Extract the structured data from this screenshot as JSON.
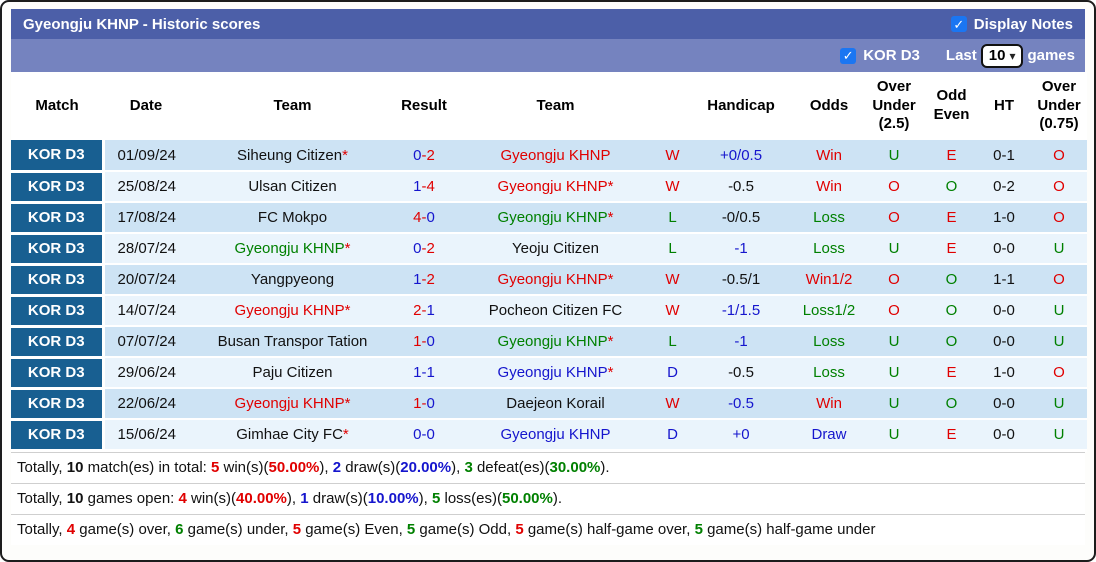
{
  "colors": {
    "red": "#e00000",
    "green": "#008000",
    "blue": "#1515cd",
    "black": "#111111",
    "titlebar_bg": "#4c5fa8",
    "subbar_bg": "#7583bf",
    "league_cell_bg": "#185f91",
    "row_stripe_dark": "#cde3f4",
    "row_stripe_light": "#eaf4fc",
    "checkbox_blue": "#1b76f2"
  },
  "header": {
    "title": "Gyeongju KHNP - Historic scores",
    "display_notes_label": "Display Notes",
    "display_notes_checked": true
  },
  "subheader": {
    "league_label": "KOR D3",
    "league_checked": true,
    "last_label": "Last",
    "games_count": "10",
    "games_label": "games"
  },
  "table": {
    "headers": [
      "Match",
      "Date",
      "Team",
      "Result",
      "Team",
      "",
      "Handicap",
      "Odds",
      "Over Under (2.5)",
      "Odd Even",
      "HT",
      "Over Under (0.75)"
    ],
    "rows": [
      {
        "league": "KOR D3",
        "date": "01/09/24",
        "home": {
          "name": "Siheung Citizen",
          "star": true,
          "color": "black"
        },
        "score": {
          "h": "0",
          "a": "2",
          "hc": "blue",
          "ac": "red",
          "dc": "red"
        },
        "away": {
          "name": "Gyeongju KHNP",
          "star": false,
          "color": "red"
        },
        "wdl": {
          "t": "W",
          "c": "red"
        },
        "handicap": {
          "t": "+0/0.5",
          "c": "blue"
        },
        "odds": {
          "t": "Win",
          "c": "red"
        },
        "ou25": {
          "t": "U",
          "c": "green"
        },
        "oddeven": {
          "t": "E",
          "c": "red"
        },
        "ht": "0-1",
        "ou075": {
          "t": "O",
          "c": "red"
        }
      },
      {
        "league": "KOR D3",
        "date": "25/08/24",
        "home": {
          "name": "Ulsan Citizen",
          "star": false,
          "color": "black"
        },
        "score": {
          "h": "1",
          "a": "4",
          "hc": "blue",
          "ac": "red",
          "dc": "red"
        },
        "away": {
          "name": "Gyeongju KHNP",
          "star": true,
          "color": "red"
        },
        "wdl": {
          "t": "W",
          "c": "red"
        },
        "handicap": {
          "t": "-0.5",
          "c": "black"
        },
        "odds": {
          "t": "Win",
          "c": "red"
        },
        "ou25": {
          "t": "O",
          "c": "red"
        },
        "oddeven": {
          "t": "O",
          "c": "green"
        },
        "ht": "0-2",
        "ou075": {
          "t": "O",
          "c": "red"
        }
      },
      {
        "league": "KOR D3",
        "date": "17/08/24",
        "home": {
          "name": "FC Mokpo",
          "star": false,
          "color": "black"
        },
        "score": {
          "h": "4",
          "a": "0",
          "hc": "red",
          "ac": "blue",
          "dc": "red"
        },
        "away": {
          "name": "Gyeongju KHNP",
          "star": true,
          "color": "green"
        },
        "wdl": {
          "t": "L",
          "c": "green"
        },
        "handicap": {
          "t": "-0/0.5",
          "c": "black"
        },
        "odds": {
          "t": "Loss",
          "c": "green"
        },
        "ou25": {
          "t": "O",
          "c": "red"
        },
        "oddeven": {
          "t": "E",
          "c": "red"
        },
        "ht": "1-0",
        "ou075": {
          "t": "O",
          "c": "red"
        }
      },
      {
        "league": "KOR D3",
        "date": "28/07/24",
        "home": {
          "name": "Gyeongju KHNP",
          "star": true,
          "color": "green"
        },
        "score": {
          "h": "0",
          "a": "2",
          "hc": "blue",
          "ac": "red",
          "dc": "red"
        },
        "away": {
          "name": "Yeoju Citizen",
          "star": false,
          "color": "black"
        },
        "wdl": {
          "t": "L",
          "c": "green"
        },
        "handicap": {
          "t": "-1",
          "c": "blue"
        },
        "odds": {
          "t": "Loss",
          "c": "green"
        },
        "ou25": {
          "t": "U",
          "c": "green"
        },
        "oddeven": {
          "t": "E",
          "c": "red"
        },
        "ht": "0-0",
        "ou075": {
          "t": "U",
          "c": "green"
        }
      },
      {
        "league": "KOR D3",
        "date": "20/07/24",
        "home": {
          "name": "Yangpyeong",
          "star": false,
          "color": "black"
        },
        "score": {
          "h": "1",
          "a": "2",
          "hc": "blue",
          "ac": "red",
          "dc": "red"
        },
        "away": {
          "name": "Gyeongju KHNP",
          "star": true,
          "color": "red"
        },
        "wdl": {
          "t": "W",
          "c": "red"
        },
        "handicap": {
          "t": "-0.5/1",
          "c": "black"
        },
        "odds": {
          "t": "Win1/2",
          "c": "red"
        },
        "ou25": {
          "t": "O",
          "c": "red"
        },
        "oddeven": {
          "t": "O",
          "c": "green"
        },
        "ht": "1-1",
        "ou075": {
          "t": "O",
          "c": "red"
        }
      },
      {
        "league": "KOR D3",
        "date": "14/07/24",
        "home": {
          "name": "Gyeongju KHNP",
          "star": true,
          "color": "red"
        },
        "score": {
          "h": "2",
          "a": "1",
          "hc": "red",
          "ac": "blue",
          "dc": "red"
        },
        "away": {
          "name": "Pocheon Citizen FC",
          "star": false,
          "color": "black"
        },
        "wdl": {
          "t": "W",
          "c": "red"
        },
        "handicap": {
          "t": "-1/1.5",
          "c": "blue"
        },
        "odds": {
          "t": "Loss1/2",
          "c": "green"
        },
        "ou25": {
          "t": "O",
          "c": "red"
        },
        "oddeven": {
          "t": "O",
          "c": "green"
        },
        "ht": "0-0",
        "ou075": {
          "t": "U",
          "c": "green"
        }
      },
      {
        "league": "KOR D3",
        "date": "07/07/24",
        "home": {
          "name": "Busan Transpor Tation",
          "star": false,
          "color": "black"
        },
        "score": {
          "h": "1",
          "a": "0",
          "hc": "red",
          "ac": "blue",
          "dc": "red"
        },
        "away": {
          "name": "Gyeongju KHNP",
          "star": true,
          "color": "green"
        },
        "wdl": {
          "t": "L",
          "c": "green"
        },
        "handicap": {
          "t": "-1",
          "c": "blue"
        },
        "odds": {
          "t": "Loss",
          "c": "green"
        },
        "ou25": {
          "t": "U",
          "c": "green"
        },
        "oddeven": {
          "t": "O",
          "c": "green"
        },
        "ht": "0-0",
        "ou075": {
          "t": "U",
          "c": "green"
        }
      },
      {
        "league": "KOR D3",
        "date": "29/06/24",
        "home": {
          "name": "Paju Citizen",
          "star": false,
          "color": "black"
        },
        "score": {
          "h": "1",
          "a": "1",
          "hc": "blue",
          "ac": "blue",
          "dc": "blue"
        },
        "away": {
          "name": "Gyeongju KHNP",
          "star": true,
          "color": "blue"
        },
        "wdl": {
          "t": "D",
          "c": "blue"
        },
        "handicap": {
          "t": "-0.5",
          "c": "black"
        },
        "odds": {
          "t": "Loss",
          "c": "green"
        },
        "ou25": {
          "t": "U",
          "c": "green"
        },
        "oddeven": {
          "t": "E",
          "c": "red"
        },
        "ht": "1-0",
        "ou075": {
          "t": "O",
          "c": "red"
        }
      },
      {
        "league": "KOR D3",
        "date": "22/06/24",
        "home": {
          "name": "Gyeongju KHNP",
          "star": true,
          "color": "red"
        },
        "score": {
          "h": "1",
          "a": "0",
          "hc": "red",
          "ac": "blue",
          "dc": "red"
        },
        "away": {
          "name": "Daejeon Korail",
          "star": false,
          "color": "black"
        },
        "wdl": {
          "t": "W",
          "c": "red"
        },
        "handicap": {
          "t": "-0.5",
          "c": "blue"
        },
        "odds": {
          "t": "Win",
          "c": "red"
        },
        "ou25": {
          "t": "U",
          "c": "green"
        },
        "oddeven": {
          "t": "O",
          "c": "green"
        },
        "ht": "0-0",
        "ou075": {
          "t": "U",
          "c": "green"
        }
      },
      {
        "league": "KOR D3",
        "date": "15/06/24",
        "home": {
          "name": "Gimhae City FC",
          "star": true,
          "color": "black"
        },
        "score": {
          "h": "0",
          "a": "0",
          "hc": "blue",
          "ac": "blue",
          "dc": "blue"
        },
        "away": {
          "name": "Gyeongju KHNP",
          "star": false,
          "color": "blue"
        },
        "wdl": {
          "t": "D",
          "c": "blue"
        },
        "handicap": {
          "t": "+0",
          "c": "blue"
        },
        "odds": {
          "t": "Draw",
          "c": "blue"
        },
        "ou25": {
          "t": "U",
          "c": "green"
        },
        "oddeven": {
          "t": "E",
          "c": "red"
        },
        "ht": "0-0",
        "ou075": {
          "t": "U",
          "c": "green"
        }
      }
    ]
  },
  "summary": [
    [
      {
        "t": "Totally, "
      },
      {
        "t": "10",
        "c": "black",
        "b": true
      },
      {
        "t": " match(es) in total: "
      },
      {
        "t": "5",
        "c": "red",
        "b": true
      },
      {
        "t": " win(s)("
      },
      {
        "t": "50.00%",
        "c": "red",
        "b": true
      },
      {
        "t": "), "
      },
      {
        "t": "2",
        "c": "blue",
        "b": true
      },
      {
        "t": " draw(s)("
      },
      {
        "t": "20.00%",
        "c": "blue",
        "b": true
      },
      {
        "t": "), "
      },
      {
        "t": "3",
        "c": "green",
        "b": true
      },
      {
        "t": " defeat(es)("
      },
      {
        "t": "30.00%",
        "c": "green",
        "b": true
      },
      {
        "t": ")."
      }
    ],
    [
      {
        "t": "Totally, "
      },
      {
        "t": "10",
        "c": "black",
        "b": true
      },
      {
        "t": " games open: "
      },
      {
        "t": "4",
        "c": "red",
        "b": true
      },
      {
        "t": " win(s)("
      },
      {
        "t": "40.00%",
        "c": "red",
        "b": true
      },
      {
        "t": "), "
      },
      {
        "t": "1",
        "c": "blue",
        "b": true
      },
      {
        "t": " draw(s)("
      },
      {
        "t": "10.00%",
        "c": "blue",
        "b": true
      },
      {
        "t": "), "
      },
      {
        "t": "5",
        "c": "green",
        "b": true
      },
      {
        "t": " loss(es)("
      },
      {
        "t": "50.00%",
        "c": "green",
        "b": true
      },
      {
        "t": ")."
      }
    ],
    [
      {
        "t": "Totally, "
      },
      {
        "t": "4",
        "c": "red",
        "b": true
      },
      {
        "t": " game(s) over, "
      },
      {
        "t": "6",
        "c": "green",
        "b": true
      },
      {
        "t": " game(s) under, "
      },
      {
        "t": "5",
        "c": "red",
        "b": true
      },
      {
        "t": " game(s) Even, "
      },
      {
        "t": "5",
        "c": "green",
        "b": true
      },
      {
        "t": " game(s) Odd, "
      },
      {
        "t": "5",
        "c": "red",
        "b": true
      },
      {
        "t": " game(s) half-game over, "
      },
      {
        "t": "5",
        "c": "green",
        "b": true
      },
      {
        "t": " game(s) half-game under"
      }
    ]
  ]
}
